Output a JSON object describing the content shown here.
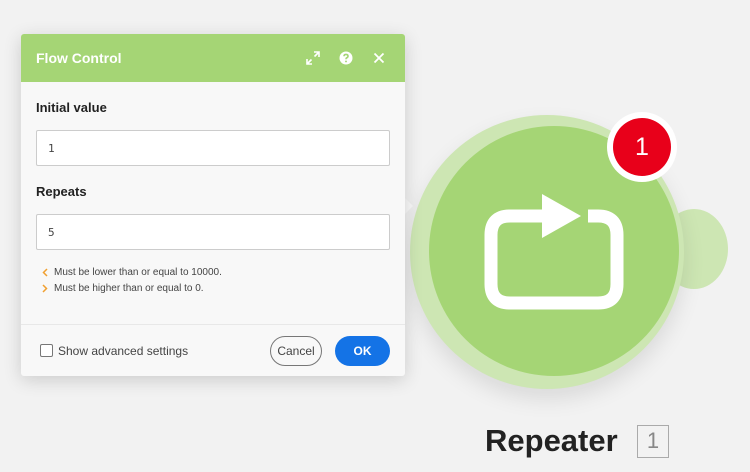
{
  "dialog": {
    "title": "Flow Control",
    "header_icons": [
      "expand-icon",
      "help-icon",
      "close-icon"
    ],
    "fields": [
      {
        "label": "Initial value",
        "value": "1"
      },
      {
        "label": "Repeats",
        "value": "5"
      }
    ],
    "hints": [
      {
        "icon": "chevron-left-icon",
        "text": "Must be lower than or equal to 10000."
      },
      {
        "icon": "chevron-right-icon",
        "text": "Must be higher than or equal to 0."
      }
    ],
    "advanced_settings_label": "Show advanced settings",
    "advanced_settings_checked": false,
    "cancel_label": "Cancel",
    "ok_label": "OK"
  },
  "module": {
    "name": "Repeater",
    "id": "1",
    "badge_count": "1",
    "icon": "repeat-icon"
  },
  "colors": {
    "header_green": "#a5d575",
    "halo_green": "#cde6b3",
    "badge_red": "#e8001a",
    "ok_blue": "#1473e6",
    "hint_orange": "#f0a030"
  }
}
